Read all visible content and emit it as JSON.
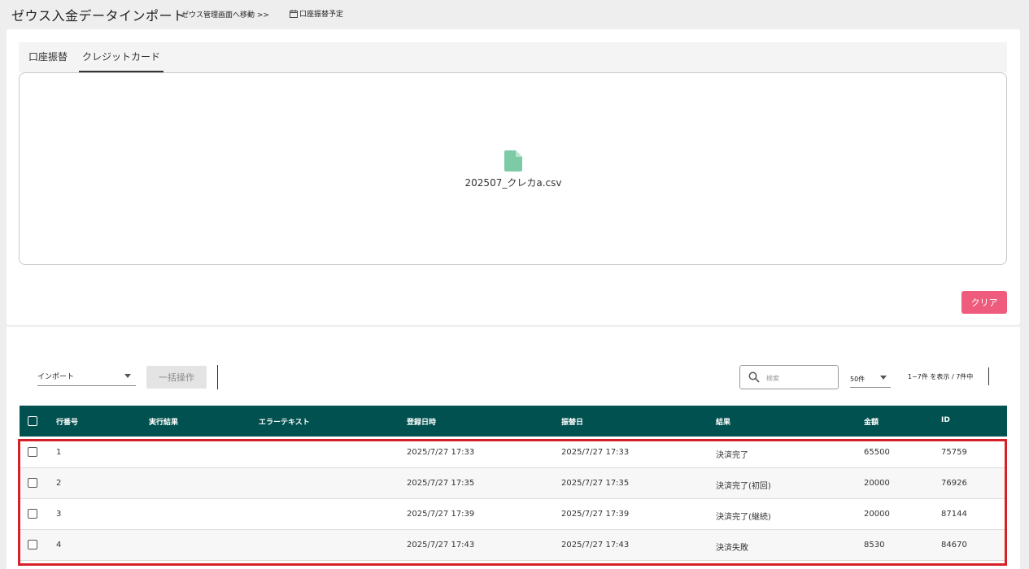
{
  "header": {
    "title": "ゼウス入金データインポート",
    "admin_link": "ゼウス管理画面へ移動 >>",
    "schedule_link": "口座振替予定"
  },
  "tabs": [
    {
      "label": "口座振替",
      "active": false
    },
    {
      "label": "クレジットカード",
      "active": true
    }
  ],
  "upload": {
    "file_name": "202507_クレカa.csv"
  },
  "clear_label": "クリア",
  "toolbar": {
    "import_select": "インポート",
    "bulk_label": "一括操作",
    "search_placeholder": "検索",
    "page_size": "50件",
    "range": "1~7件 を表示 / 7件中"
  },
  "table": {
    "columns": [
      "行番号",
      "実行結果",
      "エラーテキスト",
      "登録日時",
      "振替日",
      "結果",
      "金額",
      "ID"
    ],
    "rows": [
      {
        "no": "1",
        "exec": "",
        "error": "",
        "registered": "2025/7/27 17:33",
        "transfer": "2025/7/27 17:33",
        "result": "決済完了",
        "amount": "65500",
        "id": "75759"
      },
      {
        "no": "2",
        "exec": "",
        "error": "",
        "registered": "2025/7/27 17:35",
        "transfer": "2025/7/27 17:35",
        "result": "決済完了(初回)",
        "amount": "20000",
        "id": "76926"
      },
      {
        "no": "3",
        "exec": "",
        "error": "",
        "registered": "2025/7/27 17:39",
        "transfer": "2025/7/27 17:39",
        "result": "決済完了(継続)",
        "amount": "20000",
        "id": "87144"
      },
      {
        "no": "4",
        "exec": "",
        "error": "",
        "registered": "2025/7/27 17:43",
        "transfer": "2025/7/27 17:43",
        "result": "決済失敗",
        "amount": "8530",
        "id": "84670"
      }
    ]
  },
  "colors": {
    "header_bg": "#00514f",
    "clear_button": "#ef5b7d",
    "highlight": "#d61f26",
    "file_icon": "#7ccaa6"
  }
}
